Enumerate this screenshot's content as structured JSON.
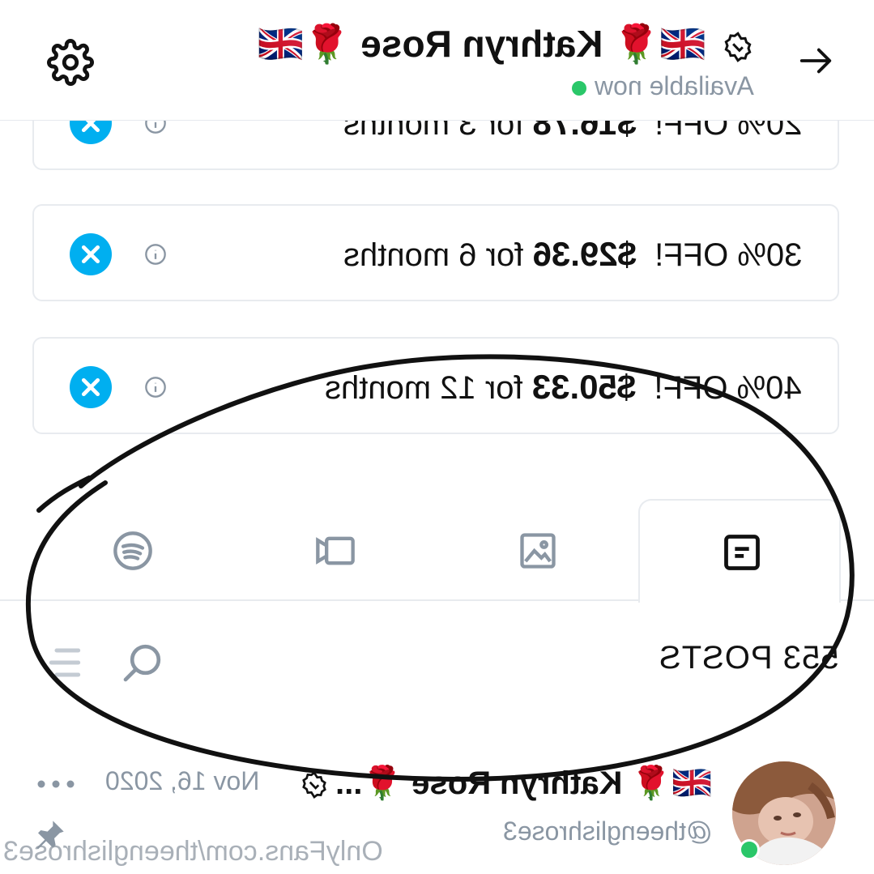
{
  "header": {
    "title": "🇬🇧🌹 Kathryn Rose 🌹🇬🇧",
    "status": "Available now"
  },
  "offers": [
    {
      "discount": "20% OFF!",
      "price": "$16.78",
      "period": "for 3 months"
    },
    {
      "discount": "30% OFF!",
      "price": "$29.36",
      "period": "for 6 months"
    },
    {
      "discount": "40% OFF!",
      "price": "$50.33",
      "period": "for 12 months"
    }
  ],
  "tabs": [
    {
      "icon": "posts-icon",
      "active": true
    },
    {
      "icon": "photo-icon",
      "active": false
    },
    {
      "icon": "video-icon",
      "active": false
    },
    {
      "icon": "spotify-icon",
      "active": false
    }
  ],
  "posts": {
    "count_label": "553 POSTS"
  },
  "post": {
    "author": "🇬🇧🌹 Kathryn Rose 🌹...",
    "handle": "@theenglishrose3",
    "date": "Nov 16, 2020"
  },
  "watermark": "OnlyFans.com/theenglishrose3",
  "colors": {
    "accent": "#00aff0",
    "online": "#2ac769",
    "muted": "#8a96a3",
    "border": "#e8ebef"
  }
}
